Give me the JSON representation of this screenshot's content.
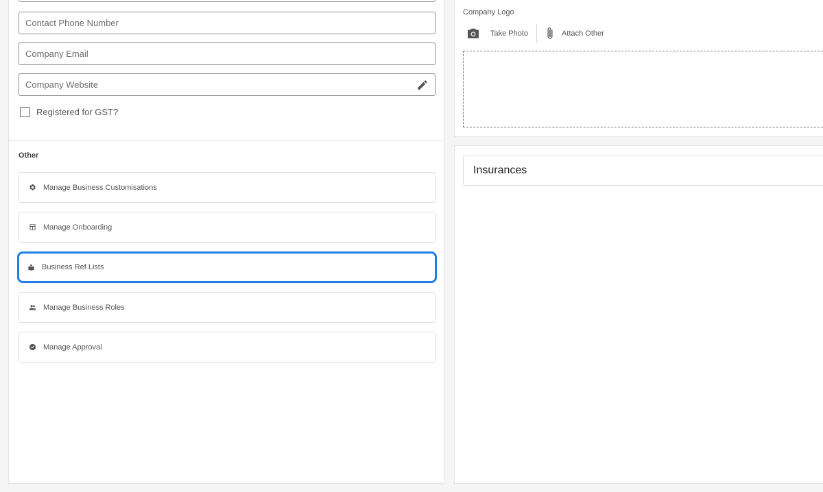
{
  "form": {
    "phone_placeholder": "Contact Phone Number",
    "email_placeholder": "Company Email",
    "website_placeholder": "Company Website",
    "gst_label": "Registered for GST?",
    "gst_checked": false
  },
  "other": {
    "section_title": "Other",
    "items": [
      {
        "label": "Manage Business Customisations",
        "icon": "gear-icon"
      },
      {
        "label": "Manage Onboarding",
        "icon": "table-icon"
      },
      {
        "label": "Business Ref Lists",
        "icon": "reading-icon",
        "highlighted": true
      },
      {
        "label": "Manage Business Roles",
        "icon": "people-icon"
      },
      {
        "label": "Manage Approval",
        "icon": "verified-icon"
      }
    ]
  },
  "logo": {
    "label": "Company Logo",
    "take_photo_label": "Take Photo",
    "attach_other_label": "Attach Other"
  },
  "insurances": {
    "title": "Insurances"
  },
  "colors": {
    "highlight": "#1e7fe6"
  }
}
